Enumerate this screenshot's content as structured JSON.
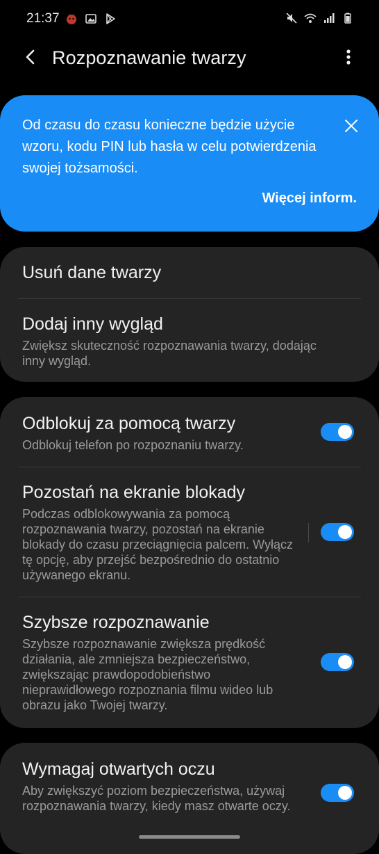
{
  "status_bar": {
    "time": "21:37",
    "left_icons": [
      "bug-notification-icon",
      "gallery-notification-icon",
      "play-store-notification-icon"
    ],
    "right_icons": [
      "mute-icon",
      "wifi-icon",
      "signal-icon",
      "battery-icon"
    ]
  },
  "header": {
    "title": "Rozpoznawanie twarzy",
    "back_icon": "back-arrow-icon",
    "more_icon": "more-options-icon"
  },
  "banner": {
    "text": "Od czasu do czasu konieczne będzie użycie wzoru, kodu PIN lub hasła w celu potwierdzenia swojej tożsamości.",
    "link": "Więcej inform.",
    "color": "#1a8cf5"
  },
  "face_data": {
    "remove_label": "Usuń dane twarzy",
    "add_look_label": "Dodaj inny wygląd",
    "add_look_desc": "Zwiększ skuteczność rozpoznawania twarzy, dodając inny wygląd."
  },
  "settings": [
    {
      "title": "Odblokuj za pomocą twarzy",
      "desc": "Odblokuj telefon po rozpoznaniu twarzy.",
      "enabled": true
    },
    {
      "title": "Pozostań na ekranie blokady",
      "desc": "Podczas odblokowywania za pomocą rozpoznawania twarzy, pozostań na ekranie blokady do czasu przeciągnięcia palcem. Wyłącz tę opcję, aby przejść bezpośrednio do ostatnio używanego ekranu.",
      "enabled": true
    },
    {
      "title": "Szybsze rozpoznawanie",
      "desc": "Szybsze rozpoznawanie zwiększa prędkość działania, ale zmniejsza bezpieczeństwo, zwiększając prawdopodobieństwo nieprawidłowego rozpoznania filmu wideo lub obrazu jako Twojej twarzy.",
      "enabled": true
    },
    {
      "title": "Wymagaj otwartych oczu",
      "desc": "Aby zwiększyć poziom bezpieczeństwa, używaj rozpoznawania twarzy, kiedy masz otwarte oczy.",
      "enabled": true
    }
  ],
  "colors": {
    "accent": "#1a8cf5",
    "card_bg": "#242424",
    "background": "#000000"
  }
}
